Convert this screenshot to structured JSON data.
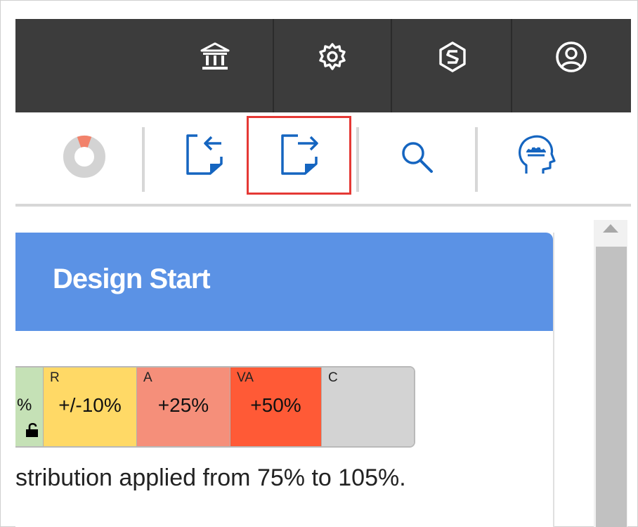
{
  "icons": {
    "top": [
      "bank-icon",
      "gear-icon",
      "integration-icon",
      "user-account-icon"
    ],
    "toolbar": [
      "progress-donut-icon",
      "import-icon",
      "export-icon",
      "search-icon",
      "head-gears-icon"
    ]
  },
  "colors": {
    "topbar": "#3c3c3c",
    "accent_blue": "#1565c0",
    "header_blue": "#5b92e5",
    "highlight_red": "#e53935"
  },
  "card": {
    "title": "Design Start",
    "scale": [
      {
        "code": "",
        "value": "%",
        "color": "#c5e1b6"
      },
      {
        "code": "R",
        "value": "+/-10%",
        "color": "#ffd966"
      },
      {
        "code": "A",
        "value": "+25%",
        "color": "#f58f7a"
      },
      {
        "code": "VA",
        "value": "+50%",
        "color": "#ff5a36"
      },
      {
        "code": "C",
        "value": "",
        "color": "#d3d3d3"
      }
    ],
    "description": "stribution applied from 75% to 105%."
  }
}
